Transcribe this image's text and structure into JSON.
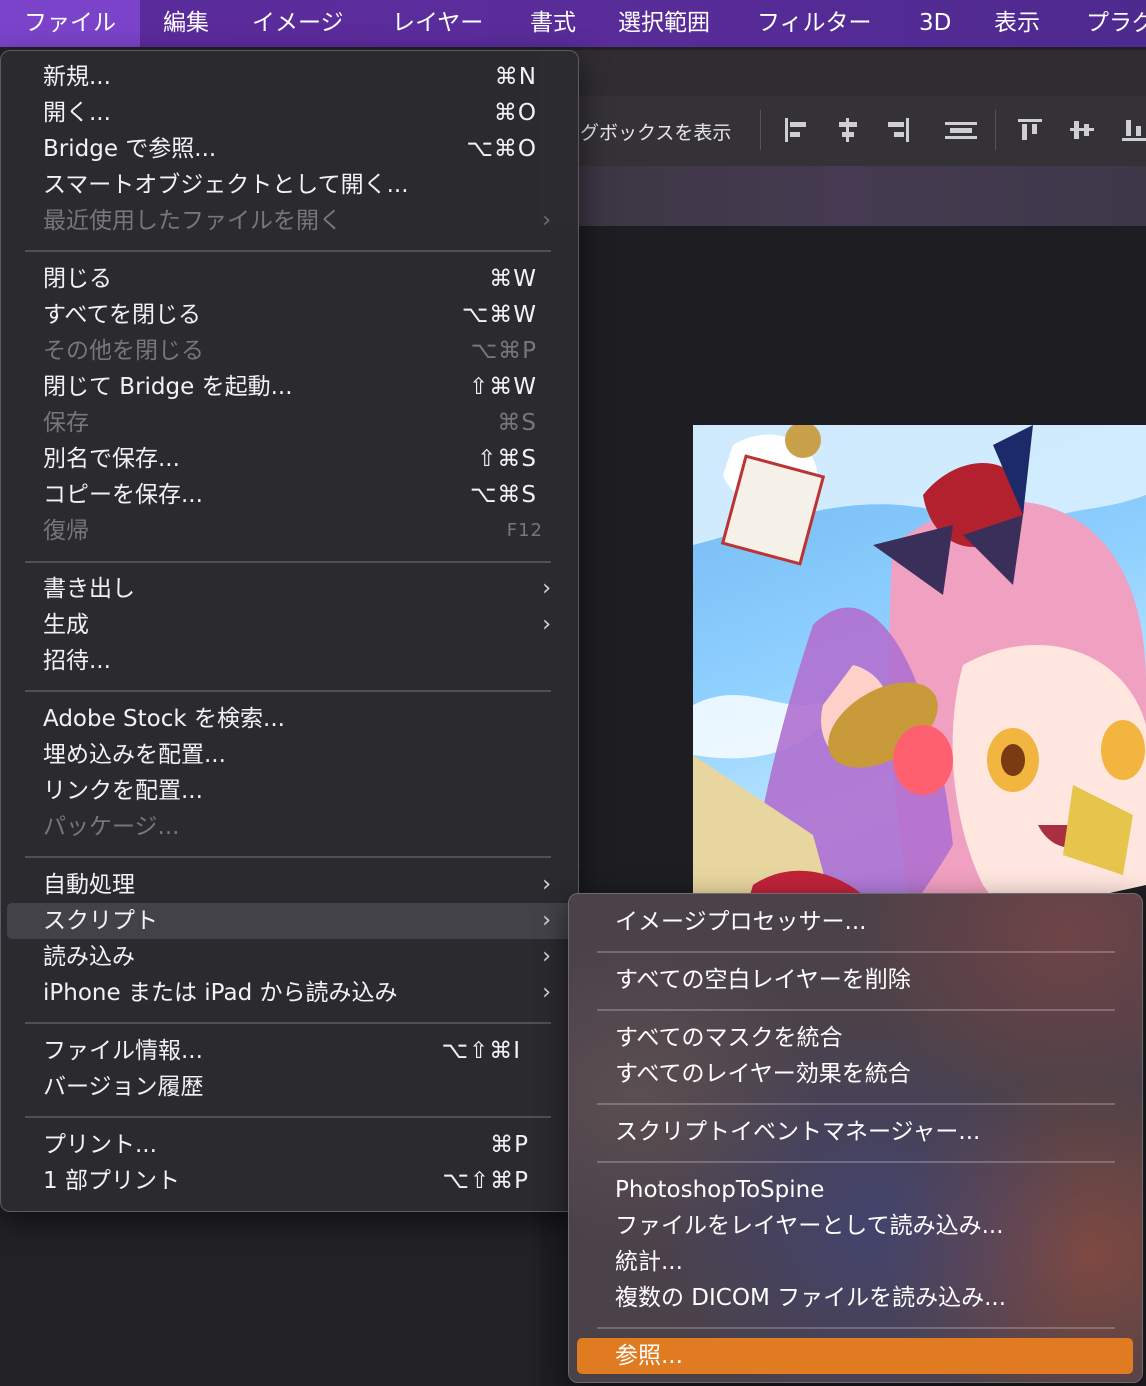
{
  "menubar": {
    "items": [
      {
        "label": "ファイル"
      },
      {
        "label": "編集"
      },
      {
        "label": "イメージ"
      },
      {
        "label": "レイヤー"
      },
      {
        "label": "書式"
      },
      {
        "label": "選択範囲"
      },
      {
        "label": "フィルター"
      },
      {
        "label": "3D"
      },
      {
        "label": "表示"
      },
      {
        "label": "プラグ"
      }
    ]
  },
  "options_bar": {
    "show_bbox_label": "グボックスを表示"
  },
  "file_menu": {
    "items": [
      {
        "label": "新規...",
        "shortcut": "⌘N"
      },
      {
        "label": "開く...",
        "shortcut": "⌘O"
      },
      {
        "label": "Bridge で参照...",
        "shortcut": "⌥⌘O"
      },
      {
        "label": "スマートオブジェクトとして開く..."
      },
      {
        "label": "最近使用したファイルを開く",
        "arrow": "›"
      },
      {
        "label": "閉じる",
        "shortcut": "⌘W"
      },
      {
        "label": "すべてを閉じる",
        "shortcut": "⌥⌘W"
      },
      {
        "label": "その他を閉じる",
        "shortcut": "⌥⌘P"
      },
      {
        "label": "閉じて Bridge を起動...",
        "shortcut": "⇧⌘W"
      },
      {
        "label": "保存",
        "shortcut": "⌘S"
      },
      {
        "label": "別名で保存...",
        "shortcut": "⇧⌘S"
      },
      {
        "label": "コピーを保存...",
        "shortcut": "⌥⌘S"
      },
      {
        "label": "復帰",
        "shortcut": "F12"
      },
      {
        "label": "書き出し",
        "arrow": "›"
      },
      {
        "label": "生成",
        "arrow": "›"
      },
      {
        "label": "招待..."
      },
      {
        "label": "Adobe Stock を検索..."
      },
      {
        "label": "埋め込みを配置..."
      },
      {
        "label": "リンクを配置..."
      },
      {
        "label": "パッケージ..."
      },
      {
        "label": "自動処理",
        "arrow": "›"
      },
      {
        "label": "スクリプト",
        "arrow": "›"
      },
      {
        "label": "読み込み",
        "arrow": "›"
      },
      {
        "label": "iPhone または iPad から読み込み",
        "arrow": "›"
      },
      {
        "label": "ファイル情報...",
        "shortcut": "⌥⇧⌘I"
      },
      {
        "label": "バージョン履歴"
      },
      {
        "label": "プリント...",
        "shortcut": "⌘P"
      },
      {
        "label": "1 部プリント",
        "shortcut": "⌥⇧⌘P"
      }
    ]
  },
  "scripts_submenu": {
    "items": [
      {
        "label": "イメージプロセッサー..."
      },
      {
        "label": "すべての空白レイヤーを削除"
      },
      {
        "label": "すべてのマスクを統合"
      },
      {
        "label": "すべてのレイヤー効果を統合"
      },
      {
        "label": "スクリプトイベントマネージャー..."
      },
      {
        "label": "PhotoshopToSpine"
      },
      {
        "label": "ファイルをレイヤーとして読み込み..."
      },
      {
        "label": "統計..."
      },
      {
        "label": "複数の DICOM ファイルを読み込み..."
      },
      {
        "label": "参照..."
      }
    ]
  },
  "colors": {
    "menubar": "#5a2a9a",
    "menubar_active": "#7a43c9",
    "menu_bg": "#2c2b30",
    "selected": "#e07b22"
  }
}
